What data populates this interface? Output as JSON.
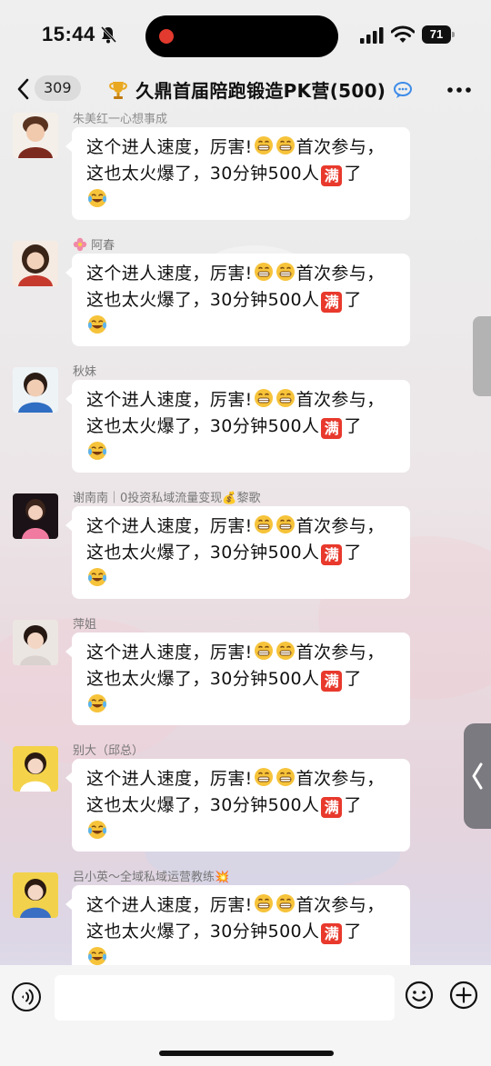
{
  "status_bar": {
    "time": "15:44",
    "battery_level": "71",
    "icons": [
      "bell-slash-icon",
      "signal-icon",
      "wifi-icon",
      "battery-icon"
    ]
  },
  "nav": {
    "back_icon": "chevron-left-icon",
    "unread_count": "309",
    "title": "久鼎首届陪跑锻造PK营(500)",
    "title_prefix_icon": "trophy-icon",
    "title_suffix_icon": "chat-bubble-icon",
    "more_icon": "ellipsis-icon"
  },
  "messages": [
    {
      "sender": "朱美红一心想事成",
      "text_1": "这个进人速度，厉害!",
      "text_2": "首次参与，这也太火爆了，30分钟500人",
      "full_label": "满",
      "text_3": "了"
    },
    {
      "sender": "阿春",
      "sender_icon": "flower-icon",
      "text_1": "这个进人速度，厉害!",
      "text_2": "首次参与，这也太火爆了，30分钟500人",
      "full_label": "满",
      "text_3": "了"
    },
    {
      "sender": "秋妹",
      "text_1": "这个进人速度，厉害!",
      "text_2": "首次参与，这也太火爆了，30分钟500人",
      "full_label": "满",
      "text_3": "了"
    },
    {
      "sender": "谢南南｜0投资私域流量变现💰黎歌",
      "text_1": "这个进人速度，厉害!",
      "text_2": "首次参与，这也太火爆了，30分钟500人",
      "full_label": "满",
      "text_3": "了"
    },
    {
      "sender": "萍姐",
      "text_1": "这个进人速度，厉害!",
      "text_2": "首次参与，这也太火爆了，30分钟500人",
      "full_label": "满",
      "text_3": "了"
    },
    {
      "sender": "别大（邱总）",
      "text_1": "这个进人速度，厉害!",
      "text_2": "首次参与，这也太火爆了，30分钟500人",
      "full_label": "满",
      "text_3": "了"
    },
    {
      "sender": "吕小英～全域私域运营教练💥",
      "text_1": "这个进人速度，厉害!",
      "text_2": "首次参与，这也太火爆了，30分钟500人",
      "full_label": "满",
      "text_3": "了"
    }
  ],
  "message_emojis": [
    "grin-icon",
    "grin-icon",
    "tears-of-joy-icon"
  ],
  "input_bar": {
    "placeholder": "",
    "icons": [
      "voice-icon",
      "emoji-face-icon",
      "plus-circle-icon"
    ]
  },
  "colors": {
    "bubble": "#ffffff",
    "full_badge": "#e8392c",
    "record_dot": "#e23a2e",
    "unread_badge_bg": "#dcdcdc"
  }
}
